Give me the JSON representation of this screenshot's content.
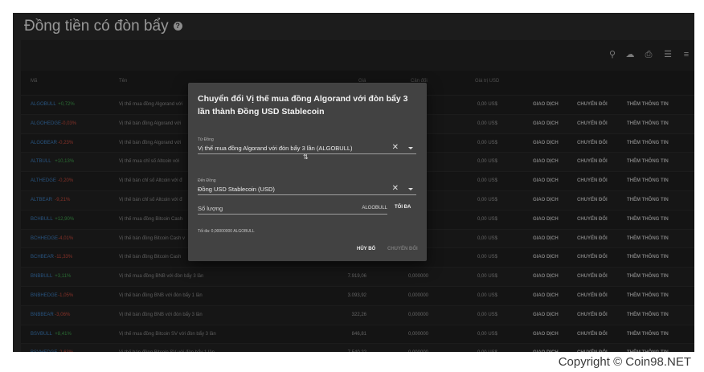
{
  "header": {
    "title": "Đồng tiền có đòn bẩy",
    "help_icon": "?"
  },
  "toolbar": {
    "icons": [
      "search-icon",
      "cloud-download-icon",
      "print-icon",
      "columns-icon",
      "filter-icon"
    ]
  },
  "table": {
    "columns": [
      "Mã",
      "Tên",
      "Giá",
      "Cân đối",
      "Giá trị USD"
    ],
    "actions": {
      "trade": "GIAO DỊCH",
      "convert": "CHUYỂN ĐỔI",
      "more": "THÊM THÔNG TIN"
    },
    "rows": [
      {
        "symbol": "ALGOBULL",
        "change": "+0,72%",
        "positive": true,
        "name": "Vị thế mua đồng Algorand với",
        "price": "",
        "balance": "",
        "usd": "0,00 US$"
      },
      {
        "symbol": "ALGOHEDGE",
        "change": "-0,03%",
        "positive": false,
        "name": "Vị thế bán đồng Algorand với",
        "price": "",
        "balance": "",
        "usd": "0,00 US$"
      },
      {
        "symbol": "ALGOBEAR",
        "change": "-0,23%",
        "positive": false,
        "name": "Vị thế bán đồng Algorand với",
        "price": "",
        "balance": "",
        "usd": "0,00 US$"
      },
      {
        "symbol": "ALTBULL",
        "change": "+10,13%",
        "positive": true,
        "name": "Vị thế mua chỉ số Altcoin với",
        "price": "",
        "balance": "",
        "usd": "0,00 US$"
      },
      {
        "symbol": "ALTHEDGE",
        "change": "-0,20%",
        "positive": false,
        "name": "Vị thế bán chỉ số Altcoin với đ",
        "price": "",
        "balance": "",
        "usd": "0,00 US$"
      },
      {
        "symbol": "ALTBEAR",
        "change": "-9,21%",
        "positive": false,
        "name": "Vị thế bán chỉ số Altcoin với đ",
        "price": "",
        "balance": "",
        "usd": "0,00 US$"
      },
      {
        "symbol": "BCHBULL",
        "change": "+12,90%",
        "positive": true,
        "name": "Vị thế mua đồng Bitcoin Cash",
        "price": "",
        "balance": "",
        "usd": "0,00 US$"
      },
      {
        "symbol": "BCHHEDGE",
        "change": "-4,01%",
        "positive": false,
        "name": "Vị thế bán đồng Bitcoin Cash v",
        "price": "",
        "balance": "",
        "usd": "0,00 US$"
      },
      {
        "symbol": "BCHBEAR",
        "change": "-11,33%",
        "positive": false,
        "name": "Vị thế bán đồng Bitcoin Cash",
        "price": "",
        "balance": "",
        "usd": "0,00 US$"
      },
      {
        "symbol": "BNBBULL",
        "change": "+3,11%",
        "positive": true,
        "name": "Vị thế mua đồng BNB với đòn bẩy 3 lần",
        "price": "7.919,06",
        "balance": "0,000000",
        "usd": "0,00 US$"
      },
      {
        "symbol": "BNBHEDGE",
        "change": "-1,05%",
        "positive": false,
        "name": "Vị thế bán đồng BNB với đòn bẩy 1 lần",
        "price": "3.093,92",
        "balance": "0,000000",
        "usd": "0,00 US$"
      },
      {
        "symbol": "BNBBEAR",
        "change": "-3,06%",
        "positive": false,
        "name": "Vị thế bán đồng BNB với đòn bẩy 3 lần",
        "price": "322,26",
        "balance": "0,000000",
        "usd": "0,00 US$"
      },
      {
        "symbol": "BSVBULL",
        "change": "+8,41%",
        "positive": true,
        "name": "Vị thế mua đồng Bitcoin SV với đòn bẩy 3 lần",
        "price": "846,81",
        "balance": "0,000000",
        "usd": "0,00 US$"
      },
      {
        "symbol": "BSVHEDGE",
        "change": "-2,63%",
        "positive": false,
        "name": "Vị thế bán đồng Bitcoin SV với đòn bẩy 1 lần",
        "price": "7.540,22",
        "balance": "0,000000",
        "usd": "0,00 US$"
      }
    ]
  },
  "dialog": {
    "title": "Chuyển đổi Vị thế mua đồng Algorand với đòn bẩy 3 lần thành Đồng USD Stablecoin",
    "from_label": "Từ Đồng",
    "from_value": "Vị thế mua đồng Algorand với đòn bẩy 3 lần (ALGOBULL)",
    "swap_icon": "⇅",
    "to_label": "Đến Đồng",
    "to_value": "Đồng USD Stablecoin (USD)",
    "amount_placeholder": "Số lượng",
    "amount_unit": "ALGOBULL",
    "max_label": "TỐI ĐA",
    "max_note": "Tối đa: 0,00000000 ALGOBULL",
    "cancel_label": "HỦY BỎ",
    "convert_label": "CHUYỂN ĐỔI"
  },
  "footer": {
    "copyright": "Copyright © Coin98.NET"
  }
}
